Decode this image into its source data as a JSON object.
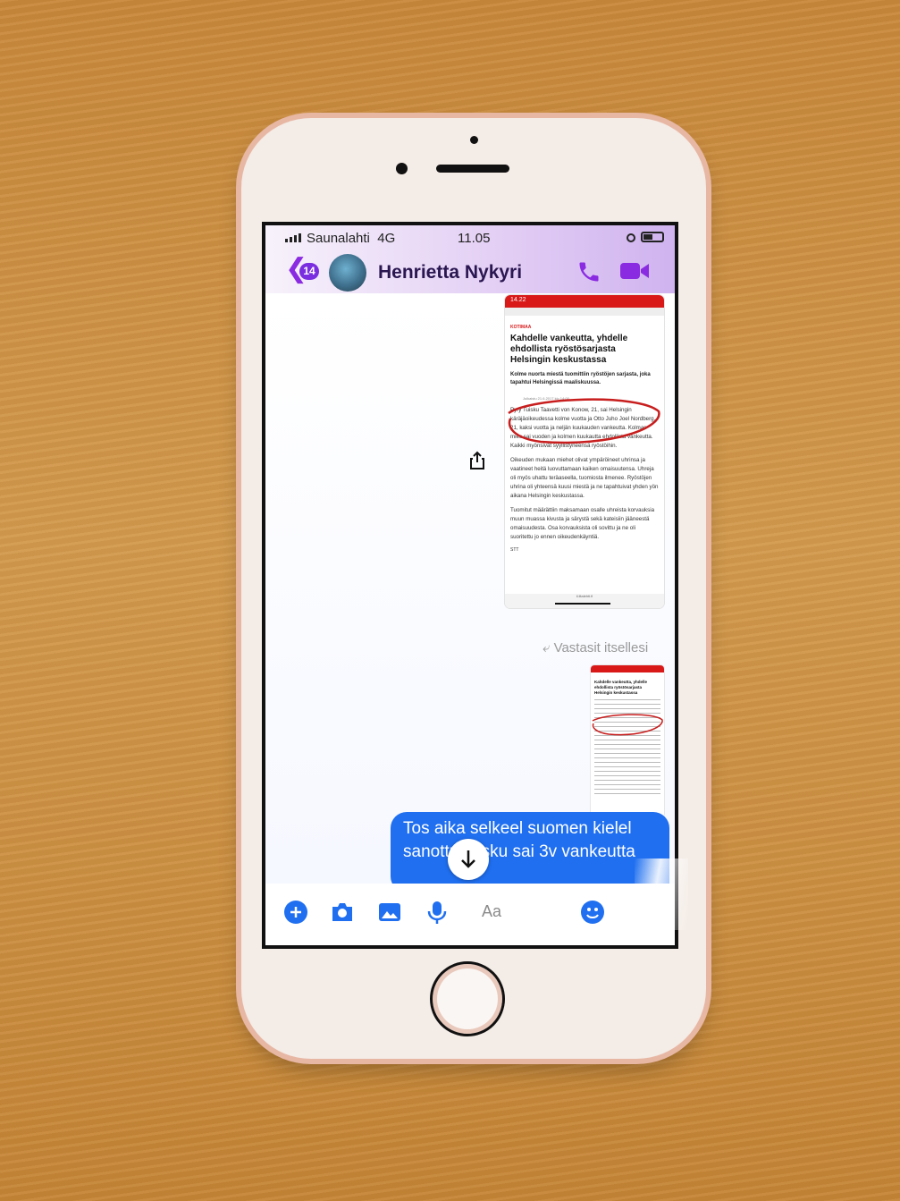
{
  "status_bar": {
    "carrier": "Saunalahti",
    "network": "4G",
    "time": "11.05"
  },
  "header": {
    "back_count": "14",
    "contact_name": "Henrietta Nykyri"
  },
  "news_screenshot": {
    "phone_time": "14.22",
    "section": "KOTIMAA",
    "title": "Kahdelle vankeutta, yhdelle ehdollista ryöstösarjasta Helsingin keskustassa",
    "lead": "Kolme nuorta miestä tuomittiin ryöstöjen sarjasta, joka tapahtui Helsingissä maaliskuussa.",
    "date": "Julkaistu 21.6.2017 klo 14:00",
    "paragraphs": [
      "Pyry Tuisku Taavetti von Konow, 21, sai Helsingin käräjäoikeudessa kolme vuotta ja Otto Juho Joel Nordberg, 21, kaksi vuotta ja neljän kuukauden vankeutta. Kolmas mies sai vuoden ja kolmen kuukautta ehdollista vankeutta. Kaikki myönsivät syyllistyneensä ryöstöihin.",
      "Oikeuden mukaan miehet olivat ympäröineet uhrinsa ja vaatineet heitä luovuttamaan kaiken omaisuutensa. Uhreja oli myös uhattu teräaseella, tuomiosta ilmenee. Ryöstöjen uhrina oli yhteensä kuusi miestä ja ne tapahtuivat yhden yön aikana Helsingin keskustassa.",
      "Tuomitut määrättiin maksamaan osalle uhreista korvauksia muun muassa kivusta ja särystä sekä kateisiin jääneestä omaisuudesta. Osa korvauksista oli sovittu ja ne oli suoritettu jo ennen oikeudenkäyntiä."
    ],
    "source": "STT",
    "footer": "il.iltalehti.fi"
  },
  "reply_label": "Vastasit itsellesi",
  "message_text": "Tos aika selkeel suomen kielel sanottu tuisku sai 3v vankeutta",
  "composer": {
    "placeholder": "Aa"
  },
  "icons": {
    "back": "chevron-left-icon",
    "call": "phone-icon",
    "video": "video-camera-icon",
    "share": "share-icon",
    "scroll": "arrow-down-icon",
    "plus": "plus-icon",
    "camera": "camera-icon",
    "gallery": "image-icon",
    "mic": "microphone-icon",
    "emoji": "emoji-icon"
  },
  "colors": {
    "accent": "#7a2ee0",
    "bubble": "#1f6ff0",
    "news_red": "#d91818",
    "call": "#8a2be2"
  }
}
